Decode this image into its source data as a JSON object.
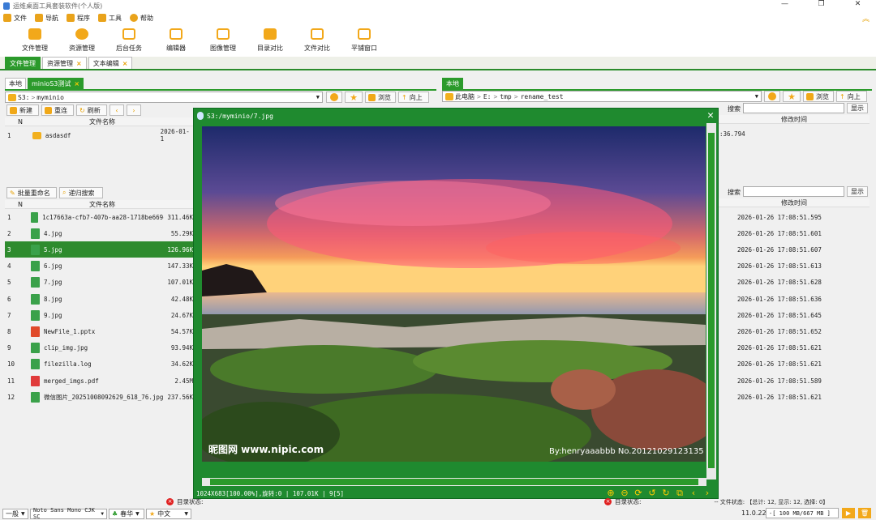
{
  "window_title": "运维桌面工具套装软件(个人版)",
  "window_controls": {
    "minimize": "—",
    "restore": "❐",
    "close": "✕"
  },
  "menu": [
    {
      "label": "文件",
      "icon": "file-icon"
    },
    {
      "label": "导航",
      "icon": "nav-icon"
    },
    {
      "label": "程序",
      "icon": "program-icon"
    },
    {
      "label": "工具",
      "icon": "tool-icon"
    },
    {
      "label": "帮助",
      "icon": "help-icon"
    }
  ],
  "toolbar": [
    "文件管理",
    "资源管理",
    "后台任务",
    "编辑器",
    "图像管理",
    "目录对比",
    "文件对比",
    "平铺窗口"
  ],
  "doc_tabs": [
    {
      "label": "文件管理",
      "active": true
    },
    {
      "label": "资源管理",
      "closable": true
    },
    {
      "label": "文本编辑",
      "closable": true
    }
  ],
  "left": {
    "tabs": [
      {
        "label": "本地"
      },
      {
        "label": "minioS3测试",
        "active": true
      }
    ],
    "address_prefix": "S3:",
    "address": "myminio",
    "browse": "浏览",
    "up": "向上",
    "new": "新建",
    "reconnect": "重连",
    "refresh": "刷新",
    "col_n": "N",
    "col_name": "文件名称",
    "top_rows": [
      {
        "n": "1",
        "name": "asdasdf",
        "date": "2026-01-1"
      }
    ],
    "batch_rename": "批量重命名",
    "recursive_search": "递归搜索",
    "files": [
      {
        "n": "1",
        "name": "1c17663a-cfb7-407b-aa28-1718be669ccc.jpg",
        "size": "311.46K",
        "type": "jpg"
      },
      {
        "n": "2",
        "name": "4.jpg",
        "size": "55.29K",
        "type": "jpg"
      },
      {
        "n": "3",
        "name": "5.jpg",
        "size": "126.96K",
        "type": "jpg",
        "selected": true
      },
      {
        "n": "4",
        "name": "6.jpg",
        "size": "147.33K",
        "type": "jpg"
      },
      {
        "n": "5",
        "name": "7.jpg",
        "size": "107.01K",
        "type": "jpg"
      },
      {
        "n": "6",
        "name": "8.jpg",
        "size": "42.48K",
        "type": "jpg"
      },
      {
        "n": "7",
        "name": "9.jpg",
        "size": "24.67K",
        "type": "jpg"
      },
      {
        "n": "8",
        "name": "NewFile_1.pptx",
        "size": "54.57K",
        "type": "pptx"
      },
      {
        "n": "9",
        "name": "clip_img.jpg",
        "size": "93.94K",
        "type": "jpg"
      },
      {
        "n": "10",
        "name": "filezilla.log",
        "size": "34.62K",
        "type": "log"
      },
      {
        "n": "11",
        "name": "merged_imgs.pdf",
        "size": "2.45M",
        "type": "pdf"
      },
      {
        "n": "12",
        "name": "微信图片_20251008092629_618_76.jpg",
        "size": "237.56K",
        "type": "jpg"
      }
    ]
  },
  "right": {
    "tabs": [
      {
        "label": "本地",
        "active": true
      }
    ],
    "path": [
      "此电脑",
      "E:",
      "tmp",
      "rename_test"
    ],
    "browse": "浏览",
    "up": "向上",
    "search_label": "搜索",
    "show_label": "显示",
    "col_mtime": "修改时间",
    "top_partial": ":36.794",
    "times": [
      "2026-01-26 17:08:51.595",
      "2026-01-26 17:08:51.601",
      "2026-01-26 17:08:51.607",
      "2026-01-26 17:08:51.613",
      "2026-01-26 17:08:51.628",
      "2026-01-26 17:08:51.636",
      "2026-01-26 17:08:51.645",
      "2026-01-26 17:08:51.652",
      "2026-01-26 17:08:51.621",
      "2026-01-26 17:08:51.621",
      "2026-01-26 17:08:51.589",
      "2026-01-26 17:08:51.621"
    ]
  },
  "viewer": {
    "title": "S3:/myminio/7.jpg",
    "watermark_left": "昵图网 www.nipic.com",
    "watermark_right": "By:henryaaabbb No.20121029123135",
    "status": "1024X683[100.00%],旋转:0 | 107.01K | 9[5]"
  },
  "status": {
    "left_label": "目录状态:",
    "right_text": "-- 文件状态: 【总计: 12, 显示: 12, 选择: 0】",
    "version": "11.0.22",
    "memory": "-[ 100 MB/667 MB ]"
  },
  "bottom": {
    "mode": "一般",
    "font": "Noto Sans Mono CJK SC",
    "skin": "春华",
    "lang": "中文"
  },
  "colors": {
    "accent": "#2b9a2b",
    "icon": "#f2a81a"
  }
}
